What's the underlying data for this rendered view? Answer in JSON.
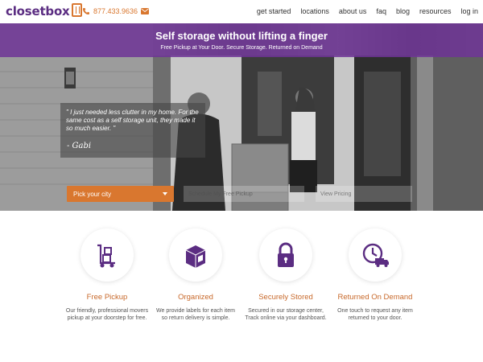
{
  "brand": {
    "logo_text": "closetbox",
    "accent": "#5b2d82",
    "orange": "#d9772f"
  },
  "header": {
    "phone": "877.433.9636",
    "nav": [
      "get started",
      "locations",
      "about us",
      "faq",
      "blog",
      "resources",
      "log in"
    ]
  },
  "hero": {
    "title": "Self storage without lifting a finger",
    "subtitle": "Free Pickup at Your Door. Secure Storage. Returned on Demand",
    "quote": "\" I just needed less clutter in my home. For the same cost as a self storage unit, they made it so much easier. \"",
    "quote_author": "- Gabi",
    "city_select": "Pick your city",
    "field_2": "Schedule My Free Pickup",
    "field_3": "View Pricing"
  },
  "features": [
    {
      "icon": "dolly-boxes-icon",
      "title": "Free Pickup",
      "desc": "Our friendly, professional movers pickup at your doorstep for free."
    },
    {
      "icon": "labeled-box-icon",
      "title": "Organized",
      "desc": "We provide labels for each item so return delivery is simple."
    },
    {
      "icon": "lock-icon",
      "title": "Securely Stored",
      "desc": "Secured in our storage center, Track online via your dashboard."
    },
    {
      "icon": "clock-truck-icon",
      "title": "Returned On Demand",
      "desc": "One touch to request any item returned to your door."
    }
  ]
}
